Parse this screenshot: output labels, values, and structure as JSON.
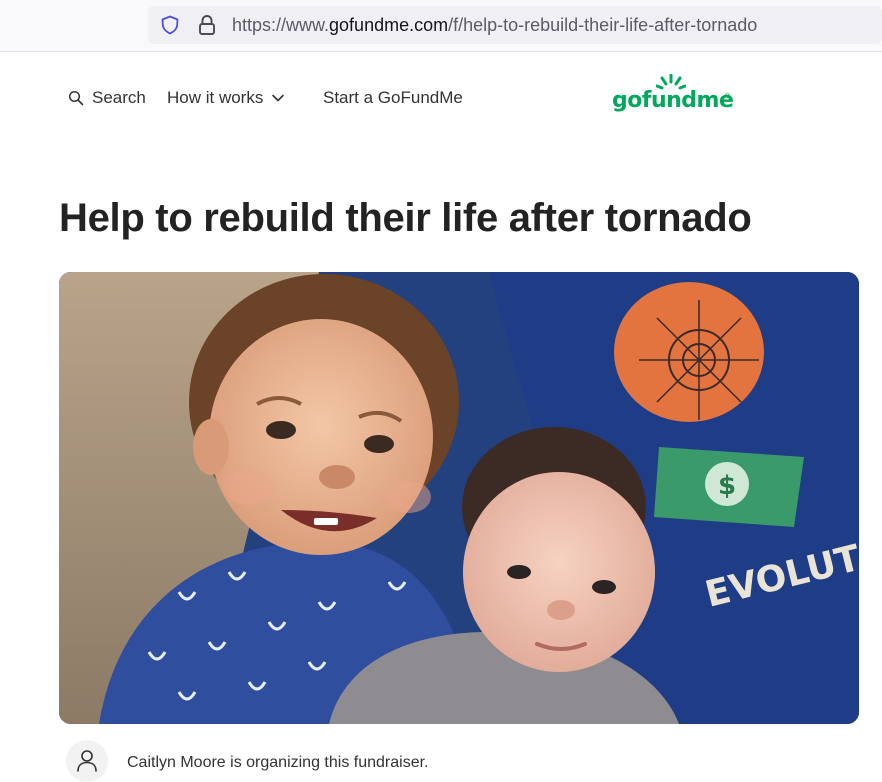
{
  "browser": {
    "url_prefix": "https://www.",
    "url_host": "gofundme.com",
    "url_path": "/f/help-to-rebuild-their-life-after-tornado",
    "icons": [
      "shield-icon",
      "lock-icon"
    ]
  },
  "nav": {
    "search_label": "Search",
    "how_it_works_label": "How it works",
    "start_label": "Start a GoFundMe",
    "icons": [
      "search-icon",
      "chevron-down-icon"
    ]
  },
  "logo": {
    "text_part1": "gof",
    "text_part2": "u",
    "text_part3": "ndme",
    "tm": "®",
    "color": "#02a95c"
  },
  "campaign": {
    "title": "Help to rebuild their life after tornado",
    "image_shirt_text": "EVOLUT"
  },
  "organizer": {
    "text": "Caitlyn Moore is organizing this fundraiser.",
    "icon": "user-icon"
  }
}
